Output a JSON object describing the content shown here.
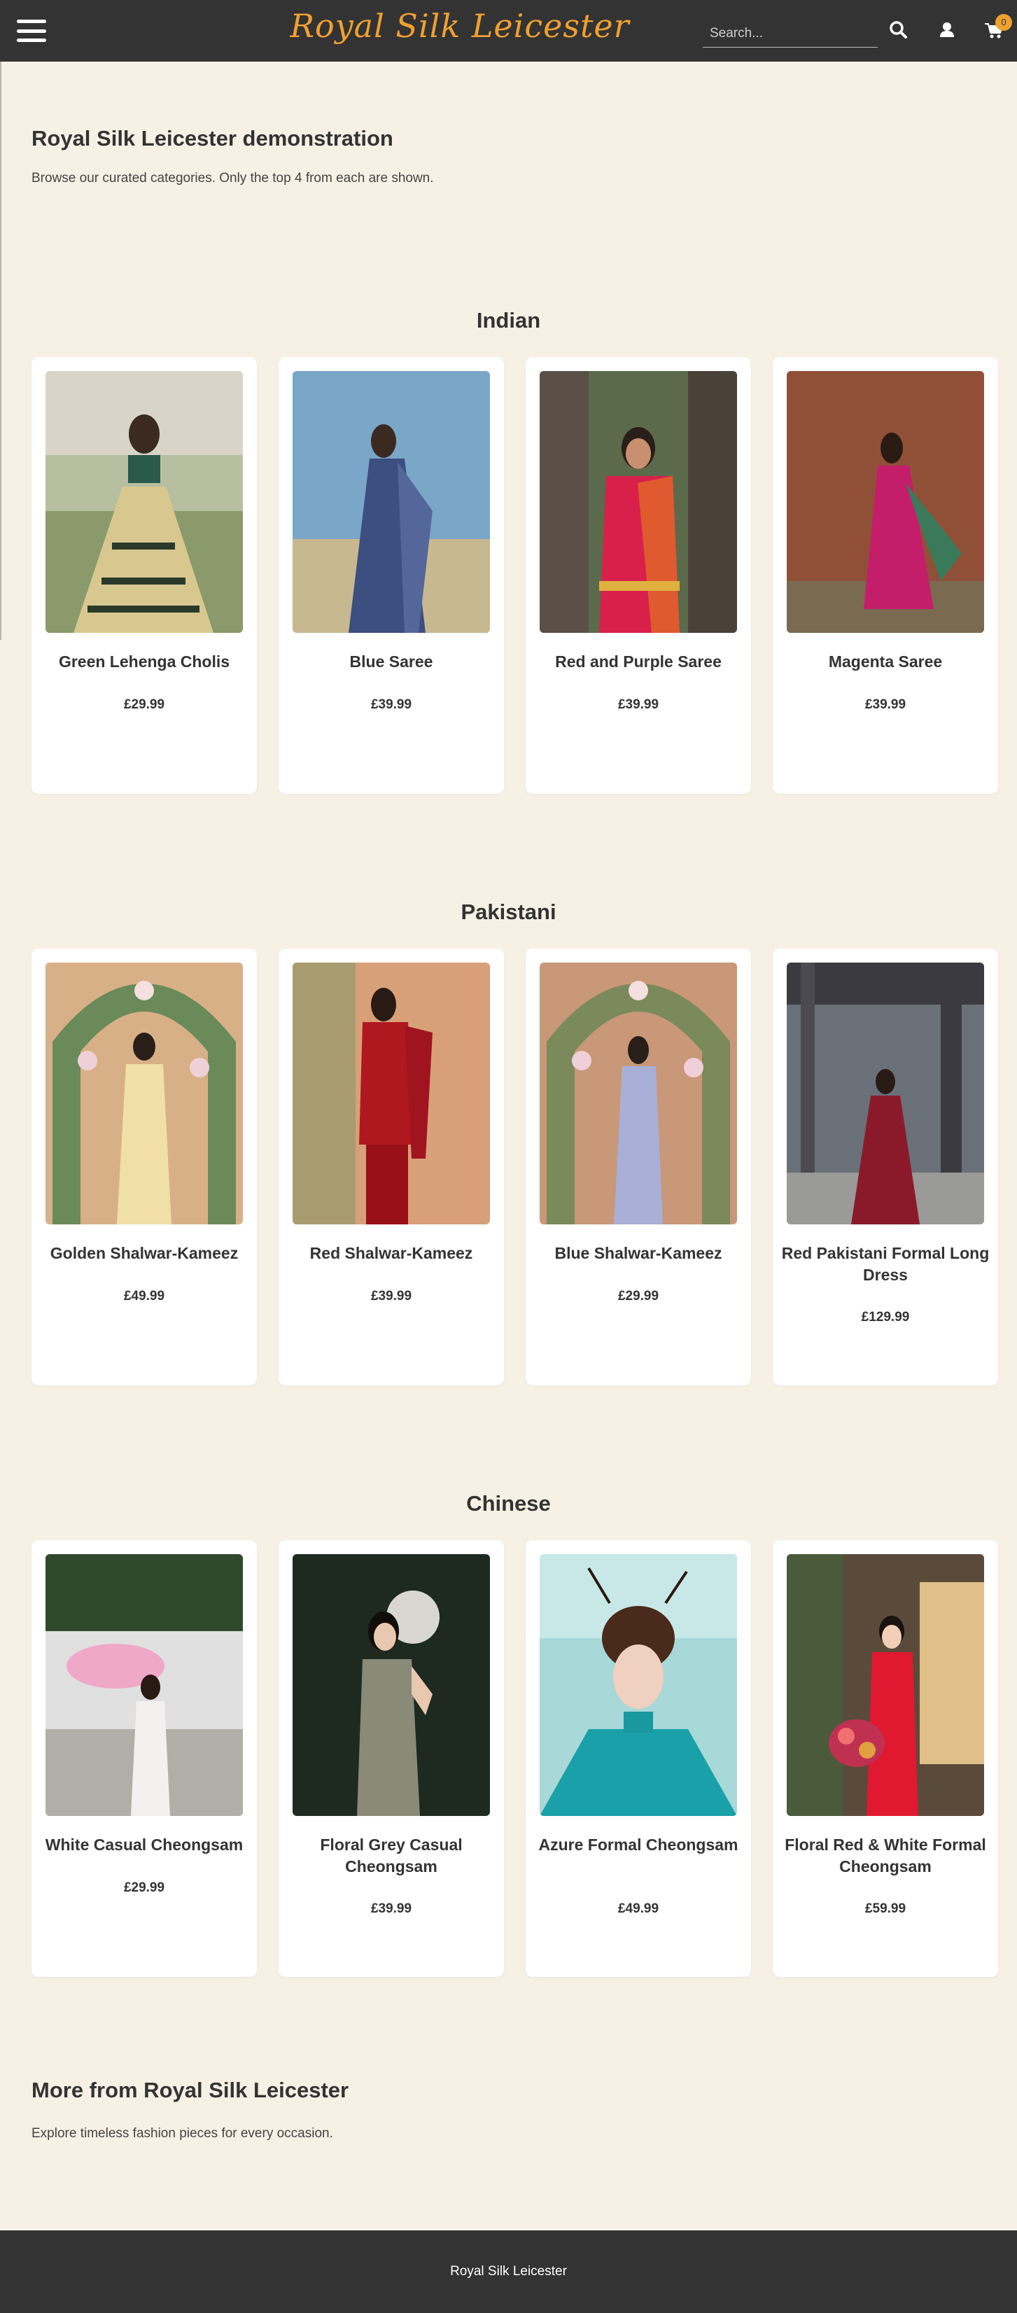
{
  "header": {
    "brand": "Royal Silk Leicester",
    "search_placeholder": "Search...",
    "cart_count": "0",
    "colors": {
      "bar": "#333333",
      "brand": "#f0a030"
    },
    "icons": [
      "menu-icon",
      "search-icon",
      "user-icon",
      "cart-icon"
    ]
  },
  "intro": {
    "title": "Royal Silk Leicester demonstration",
    "subtitle": "Browse our curated categories. Only the top 4 from each are shown."
  },
  "sections": [
    {
      "title": "Indian",
      "products": [
        {
          "name": "Green Lehenga Cholis",
          "price": "£29.99"
        },
        {
          "name": "Blue Saree",
          "price": "£39.99"
        },
        {
          "name": "Red and Purple Saree",
          "price": "£39.99"
        },
        {
          "name": "Magenta Saree",
          "price": "£39.99"
        }
      ]
    },
    {
      "title": "Pakistani",
      "products": [
        {
          "name": "Golden Shalwar-Kameez",
          "price": "£49.99"
        },
        {
          "name": "Red Shalwar-Kameez",
          "price": "£39.99"
        },
        {
          "name": "Blue Shalwar-Kameez",
          "price": "£29.99"
        },
        {
          "name": "Red Pakistani Formal Long Dress",
          "price": "£129.99"
        }
      ]
    },
    {
      "title": "Chinese",
      "products": [
        {
          "name": "White Casual Cheongsam",
          "price": "£29.99"
        },
        {
          "name": "Floral Grey Casual Cheongsam",
          "price": "£39.99"
        },
        {
          "name": "Azure Formal Cheongsam",
          "price": "£49.99"
        },
        {
          "name": "Floral Red & White Formal Cheongsam",
          "price": "£59.99"
        }
      ]
    }
  ],
  "more": {
    "title": "More from Royal Silk Leicester",
    "subtitle": "Explore timeless fashion pieces for every occasion."
  },
  "footer": {
    "text": "Royal Silk Leicester"
  }
}
